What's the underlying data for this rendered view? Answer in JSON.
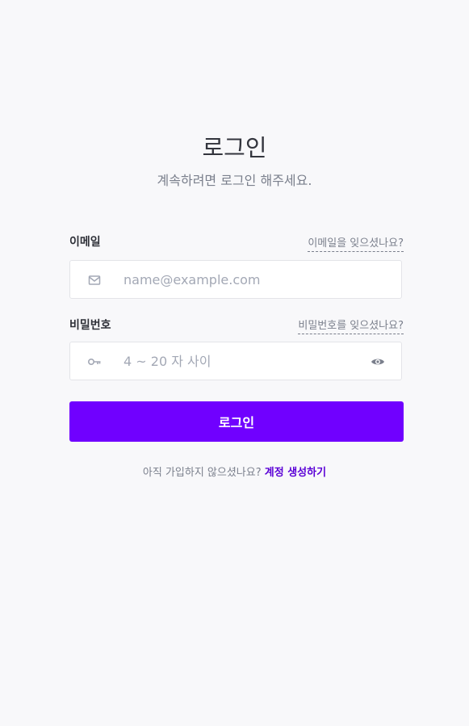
{
  "header": {
    "title": "로그인",
    "subtitle": "계속하려면 로그인 해주세요."
  },
  "form": {
    "email": {
      "label": "이메일",
      "forgot_link": "이메일을 잊으셨나요?",
      "placeholder": "name@example.com",
      "value": "",
      "icon": "mail-icon"
    },
    "password": {
      "label": "비밀번호",
      "forgot_link": "비밀번호를 잊으셨나요?",
      "placeholder": "4 ~ 20 자 사이",
      "value": "",
      "icon": "key-icon",
      "toggle_icon": "eye-icon"
    },
    "submit_label": "로그인"
  },
  "footer": {
    "prompt": "아직 가입하지 않으셨나요?",
    "signup_link": "계정 생성하기"
  },
  "colors": {
    "background": "#f8f8fa",
    "primary": "#7000ff",
    "link": "#5a00d6",
    "text": "#33353d",
    "muted": "#7a7f8c",
    "placeholder": "#a3a8b5",
    "icon": "#a3a8b5",
    "border": "#e3e4e8"
  }
}
